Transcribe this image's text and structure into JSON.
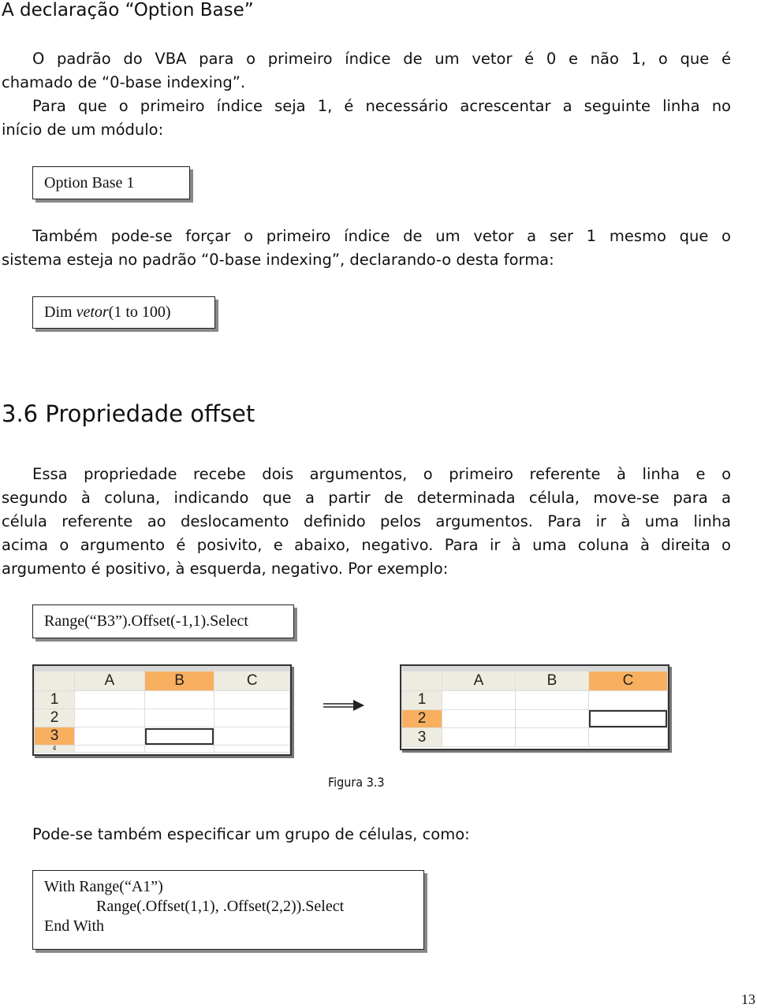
{
  "heading1": "A declaração “Option Base”",
  "para1": [
    "O padrão do VBA para o primeiro índice de um vetor é 0 e não 1, o que é",
    "chamado de “0-base indexing”."
  ],
  "para2": [
    "Para que o primeiro índice seja 1, é necessário acrescentar a seguinte linha no",
    "início de um  módulo:"
  ],
  "code1": "Option Base 1",
  "para3": [
    "Também pode-se forçar o primeiro índice de um vetor a ser 1 mesmo que o",
    "sistema esteja no padrão “0-base indexing”, declarando-o desta forma:"
  ],
  "code2": {
    "a": "Dim ",
    "b": "vetor",
    "c": "(1 to 100)"
  },
  "heading2": "3.6 Propriedade offset",
  "para4": [
    "Essa propriedade recebe dois argumentos, o primeiro referente à linha e o",
    "segundo à coluna, indicando que a partir de determinada célula, move-se para a",
    "célula referente ao deslocamento definido pelos argumentos. Para ir à uma linha",
    "acima o argumento é posivito, e abaixo, negativo. Para ir à uma coluna à direita o",
    "argumento é positivo, à esquerda, negativo. Por exemplo:"
  ],
  "code3": "Range(“B3”).Offset(-1,1).Select",
  "figure": {
    "columns": [
      "A",
      "B",
      "C"
    ],
    "left_rows": [
      "1",
      "2",
      "3",
      "4"
    ],
    "right_rows": [
      "1",
      "2",
      "3"
    ],
    "highlight_color": "#f8b060",
    "caption": "Figura 3.3"
  },
  "para5": [
    "Pode-se também especificar um grupo de células, como:"
  ],
  "code4": [
    "With Range(“A1”)",
    "Range(.Offset(1,1), .Offset(2,2)).Select",
    "End With"
  ],
  "page_number": "13"
}
